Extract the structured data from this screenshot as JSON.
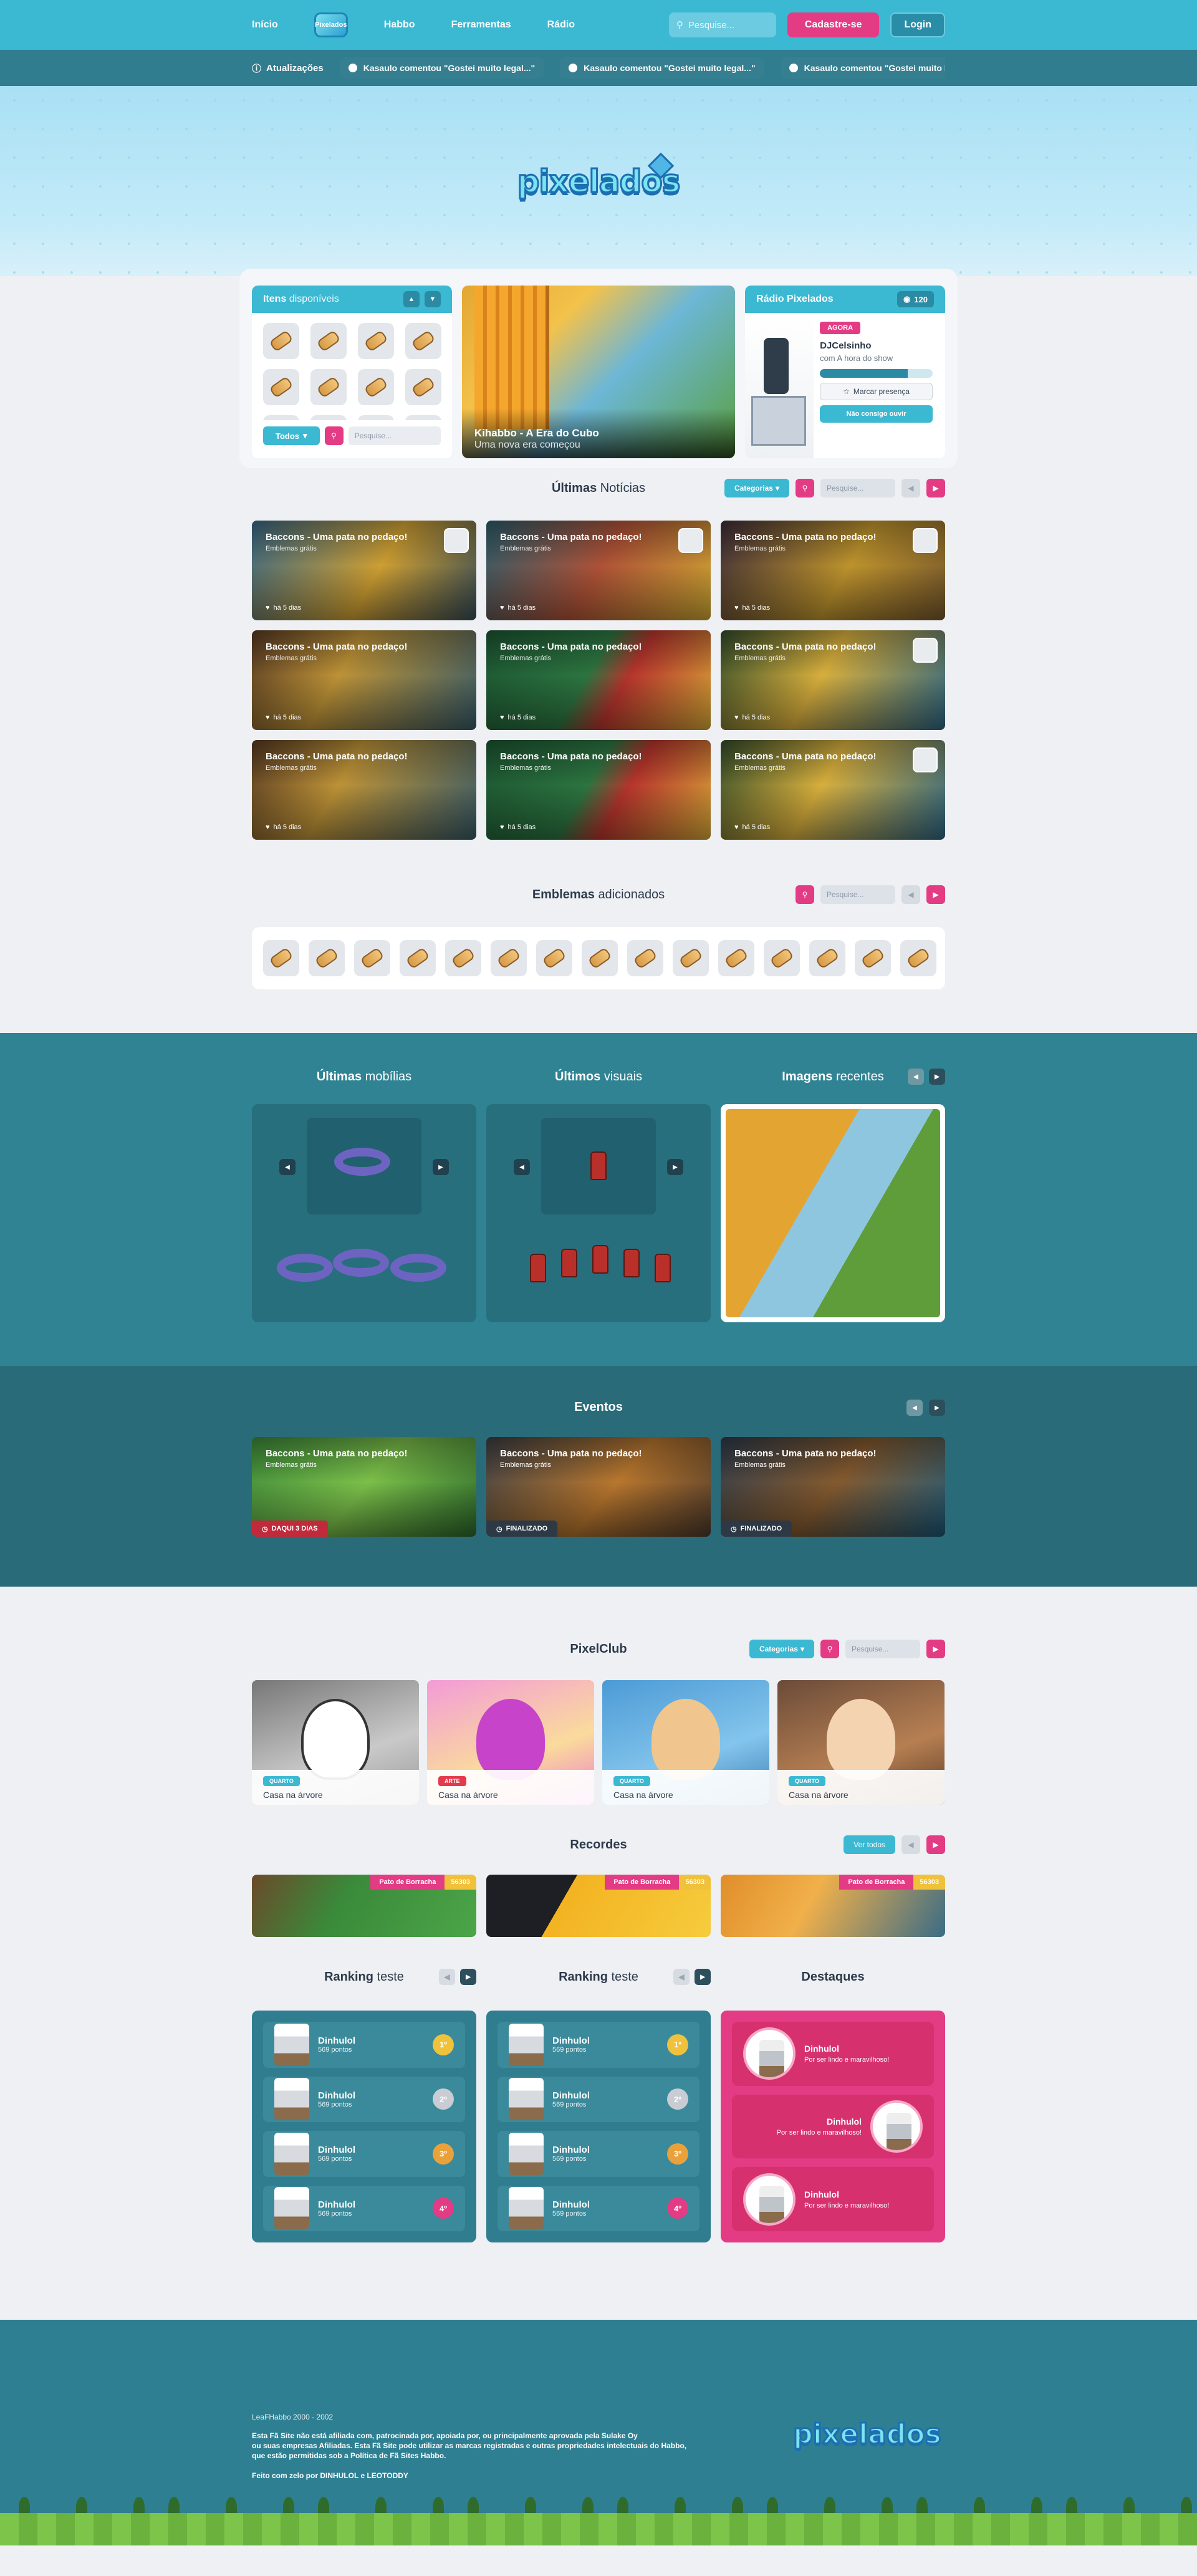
{
  "nav": {
    "links": [
      "Início",
      "Pixelados",
      "Habbo",
      "Ferramentas",
      "Rádio"
    ],
    "search_placeholder": "Pesquise...",
    "signup": "Cadastre-se",
    "login": "Login"
  },
  "ticker": {
    "label": "Atualizações",
    "items": [
      "Kasaulo comentou \"Gostei muito legal...\"",
      "Kasaulo comentou \"Gostei muito legal...\"",
      "Kasaulo comentou \"Gostei muito legal...\""
    ]
  },
  "hero": {
    "logo_text": "pixelados"
  },
  "items_panel": {
    "title_bold": "Itens",
    "title_light": "disponíveis",
    "filter_label": "Todos",
    "search_placeholder": "Pesquise..."
  },
  "feature": {
    "title": "Kihabbo - A Era do Cubo",
    "subtitle": "Uma nova era começou"
  },
  "radio": {
    "title": "Rádio Pixelados",
    "listeners": "120",
    "status": "AGORA",
    "dj": "DJCelsinho",
    "show": "com A hora do show",
    "progress": 0.78,
    "mark_presence": "Marcar presença",
    "sing": "Não consigo ouvir"
  },
  "news": {
    "title_bold": "Últimas",
    "title_light": "Notícias",
    "category": "Categorias",
    "search_placeholder": "Pesquise...",
    "cards": [
      {
        "title": "Baccons - Uma pata no pedaço!",
        "sub": "Emblemas grátis",
        "date": "há 5 dias"
      },
      {
        "title": "Baccons - Uma pata no pedaço!",
        "sub": "Emblemas grátis",
        "date": "há 5 dias"
      },
      {
        "title": "Baccons - Uma pata no pedaço!",
        "sub": "Emblemas grátis",
        "date": "há 5 dias"
      },
      {
        "title": "Baccons - Uma pata no pedaço!",
        "sub": "Emblemas grátis",
        "date": "há 5 dias"
      },
      {
        "title": "Baccons - Uma pata no pedaço!",
        "sub": "Emblemas grátis",
        "date": "há 5 dias"
      },
      {
        "title": "Baccons - Uma pata no pedaço!",
        "sub": "Emblemas grátis",
        "date": "há 5 dias"
      },
      {
        "title": "Baccons - Uma pata no pedaço!",
        "sub": "Emblemas grátis",
        "date": "há 5 dias"
      },
      {
        "title": "Baccons - Uma pata no pedaço!",
        "sub": "Emblemas grátis",
        "date": "há 5 dias"
      },
      {
        "title": "Baccons - Uma pata no pedaço!",
        "sub": "Emblemas grátis",
        "date": "há 5 dias"
      }
    ]
  },
  "emblems": {
    "title_bold": "Emblemas",
    "title_light": "adicionados",
    "search_placeholder": "Pesquise..."
  },
  "teal": {
    "col1_bold": "Últimas",
    "col1_light": "mobílias",
    "col2_bold": "Últimos",
    "col2_light": "visuais",
    "col3_bold": "Imagens",
    "col3_light": "recentes"
  },
  "events": {
    "title": "Eventos",
    "cards": [
      {
        "title": "Baccons - Uma pata no pedaço!",
        "sub": "Emblemas grátis",
        "status": "DAQUI 3 DIAS"
      },
      {
        "title": "Baccons - Uma pata no pedaço!",
        "sub": "Emblemas grátis",
        "status": "FINALIZADO"
      },
      {
        "title": "Baccons - Uma pata no pedaço!",
        "sub": "Emblemas grátis",
        "status": "FINALIZADO"
      }
    ]
  },
  "club": {
    "title": "PixelClub",
    "category": "Categorias",
    "search_placeholder": "Pesquise...",
    "cards": [
      {
        "tag": "QUARTO",
        "name": "Casa na árvore"
      },
      {
        "tag": "ARTE",
        "name": "Casa na árvore"
      },
      {
        "tag": "QUARTO",
        "name": "Casa na árvore"
      },
      {
        "tag": "QUARTO",
        "name": "Casa na árvore"
      }
    ],
    "colors": {
      "quarto": "#3bb8d2",
      "arte": "#e33b4c"
    }
  },
  "records": {
    "title": "Recordes",
    "see_all": "Ver todos",
    "cards": [
      {
        "name": "Pato de Borracha",
        "value": "56303"
      },
      {
        "name": "Pato de Borracha",
        "value": "56303"
      },
      {
        "name": "Pato de Borracha",
        "value": "56303"
      }
    ]
  },
  "ranking": {
    "title_bold": "Ranking",
    "title_light": "teste",
    "rows": [
      {
        "name": "Dinhulol",
        "points": "569 pontos",
        "pos": "1º"
      },
      {
        "name": "Dinhulol",
        "points": "569 pontos",
        "pos": "2º"
      },
      {
        "name": "Dinhulol",
        "points": "569 pontos",
        "pos": "3º"
      },
      {
        "name": "Dinhulol",
        "points": "569 pontos",
        "pos": "4º"
      }
    ]
  },
  "highlights": {
    "title": "Destaques",
    "rows": [
      {
        "name": "Dinhulol",
        "sub": "Por ser lindo e maravilhoso!"
      },
      {
        "name": "Dinhulol",
        "sub": "Por ser lindo e maravilhoso!"
      },
      {
        "name": "Dinhulol",
        "sub": "Por ser lindo e maravilhoso!"
      }
    ]
  },
  "footer": {
    "copyright": "LeaFHabbo 2000 - 2002",
    "line1": "Esta Fã Site não está afiliada com, patrocinada por, apoiada por, ou principalmente aprovada pela Sulake Oy",
    "line2": "ou suas empresas Afiliadas. Esta Fã Site pode utilizar as marcas registradas e outras propriedades intelectuais do Habbo,",
    "line3": "que estão permitidas sob a Política de Fã Sites Habbo.",
    "made": "Feito com zelo por DINHULOL e LEOTODDY",
    "logo_text": "pixelados"
  }
}
